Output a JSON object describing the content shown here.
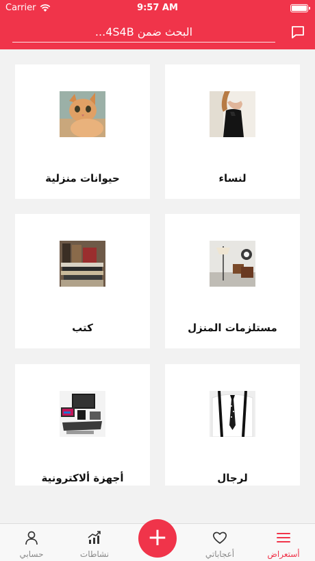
{
  "status_bar": {
    "carrier": "Carrier",
    "time": "9:57 AM"
  },
  "header": {
    "search_placeholder": "البحث ضمن 4S4B...",
    "accent_color": "#f0344a",
    "chat_icon": "chat-bubble-icon"
  },
  "categories": [
    {
      "label": "لنساء",
      "image": "woman-black-top-photo"
    },
    {
      "label": "حيوانات منزلية",
      "image": "kitten-photo"
    },
    {
      "label": "مستلزمات المنزل",
      "image": "home-decor-photo"
    },
    {
      "label": "كتب",
      "image": "books-stack-photo"
    },
    {
      "label": "لرجال",
      "image": "man-suspenders-tie-photo"
    },
    {
      "label": "أجهزة ألاكترونية",
      "image": "electronics-photo"
    }
  ],
  "tabbar": {
    "tabs": [
      {
        "label": "أستعراض",
        "icon": "menu-icon",
        "active": true
      },
      {
        "label": "أعجاباتي",
        "icon": "heart-icon",
        "active": false
      },
      {
        "label": "نشاطات",
        "icon": "activity-chart-icon",
        "active": false
      },
      {
        "label": "حسابي",
        "icon": "person-icon",
        "active": false
      }
    ],
    "add_label": "+"
  }
}
